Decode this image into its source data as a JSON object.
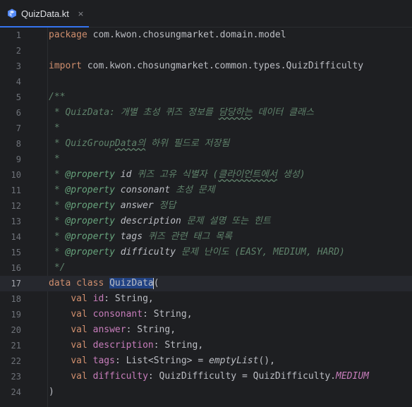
{
  "tab": {
    "title": "QuizData.kt",
    "close": "×",
    "icon": "kotlin-file-icon"
  },
  "colors": {
    "accent": "#3574f0",
    "keyword": "#cf8e6d",
    "doc": "#5f826b",
    "property": "#c77dbb",
    "selection": "#214283"
  },
  "current_line": 17,
  "lines": {
    "l1": {
      "n": "1",
      "t": [
        "package",
        " com.kwon.chosungmarket.domain.model"
      ]
    },
    "l2": {
      "n": "2"
    },
    "l3": {
      "n": "3",
      "t": [
        "import",
        " com.kwon.chosungmarket.common.types.QuizDifficulty"
      ]
    },
    "l4": {
      "n": "4"
    },
    "l5": {
      "n": "5",
      "t": [
        "/**"
      ]
    },
    "l6": {
      "n": "6",
      "t": [
        " * QuizData: 개별 초성 퀴즈 정보를 ",
        "담당하는",
        " 데이터 클래스"
      ]
    },
    "l7": {
      "n": "7",
      "t": [
        " *"
      ]
    },
    "l8": {
      "n": "8",
      "t": [
        " * QuizGroup",
        "Data의",
        " 하위 필드로 저장됨"
      ]
    },
    "l9": {
      "n": "9",
      "t": [
        " *"
      ]
    },
    "l10": {
      "n": "10",
      "t": [
        " * ",
        "@property",
        " id",
        " 퀴즈 고유 식별자 (",
        "클라이언트에서",
        " 생성)"
      ]
    },
    "l11": {
      "n": "11",
      "t": [
        " * ",
        "@property",
        " consonant",
        " 초성 문제"
      ]
    },
    "l12": {
      "n": "12",
      "t": [
        " * ",
        "@property",
        " answer",
        " 정답"
      ]
    },
    "l13": {
      "n": "13",
      "t": [
        " * ",
        "@property",
        " description",
        " 문제 설명 또는 힌트"
      ]
    },
    "l14": {
      "n": "14",
      "t": [
        " * ",
        "@property",
        " tags",
        " 퀴즈 관련 태그 목록"
      ]
    },
    "l15": {
      "n": "15",
      "t": [
        " * ",
        "@property",
        " difficulty",
        " 문제 난이도 (EASY, MEDIUM, HARD)"
      ]
    },
    "l16": {
      "n": "16",
      "t": [
        " */"
      ]
    },
    "l17": {
      "n": "17",
      "t": [
        "data class",
        " ",
        "QuizData",
        "("
      ]
    },
    "l18": {
      "n": "18",
      "t": [
        "    ",
        "val",
        " ",
        "id",
        ": String,"
      ]
    },
    "l19": {
      "n": "19",
      "t": [
        "    ",
        "val",
        " ",
        "consonant",
        ": String,"
      ]
    },
    "l20": {
      "n": "20",
      "t": [
        "    ",
        "val",
        " ",
        "answer",
        ": String,"
      ]
    },
    "l21": {
      "n": "21",
      "t": [
        "    ",
        "val",
        " ",
        "description",
        ": String,"
      ]
    },
    "l22": {
      "n": "22",
      "t": [
        "    ",
        "val",
        " ",
        "tags",
        ": List<String> = ",
        "emptyList",
        "(),"
      ]
    },
    "l23": {
      "n": "23",
      "t": [
        "    ",
        "val",
        " ",
        "difficulty",
        ": QuizDifficulty = QuizDifficulty.",
        "MEDIUM"
      ]
    },
    "l24": {
      "n": "24",
      "t": [
        ")"
      ]
    }
  }
}
